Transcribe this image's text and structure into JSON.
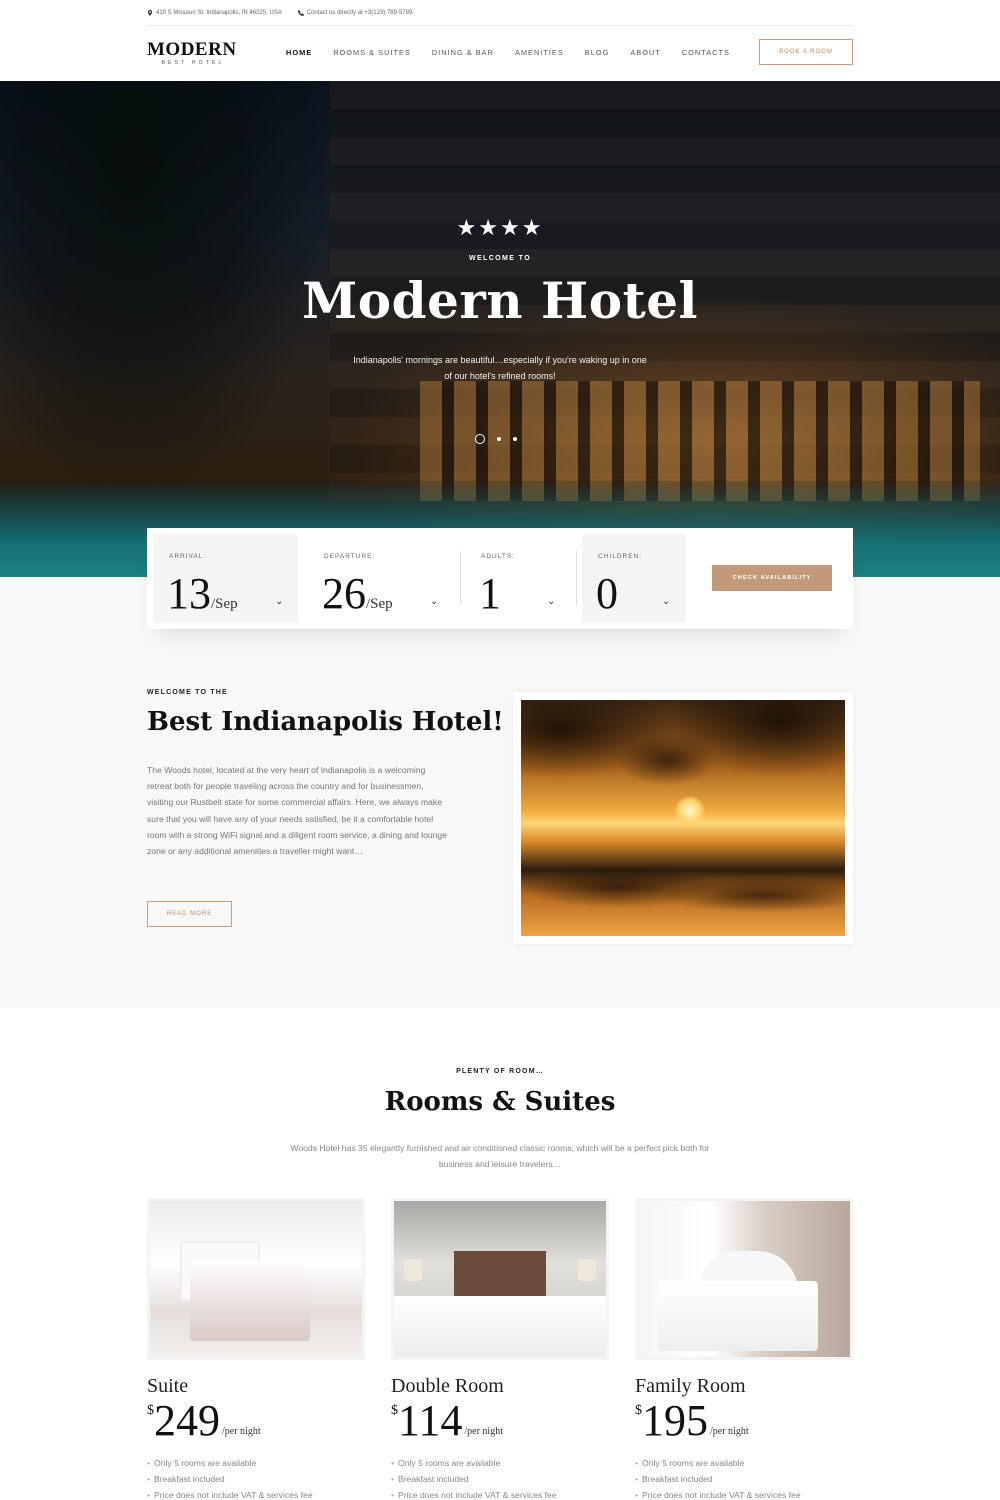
{
  "topbar": {
    "address": "410 S Missouri St, Indianapolis, IN 46225, USA",
    "contact": "Contact us directly at +3(123) 789-5789"
  },
  "header": {
    "logo_name": "MODERN",
    "logo_sub": "BEST HOTEL",
    "nav": [
      "HOME",
      "ROOMS & SUITES",
      "DINING & BAR",
      "AMENITIES",
      "BLOG",
      "ABOUT",
      "CONTACTS"
    ],
    "active_nav": "HOME",
    "book_label": "BOOK A ROOM"
  },
  "hero": {
    "stars": "★★★★",
    "welcome": "WELCOME TO",
    "title": "Modern Hotel",
    "desc_line1": "Indianapolis' mornings are beautiful…especially if you're waking up in one",
    "desc_line2": "of our hotel's refined rooms!",
    "slides": 3,
    "active_slide": 1
  },
  "booking": {
    "arrival_label": "ARRIVAL:",
    "arrival_day": "13",
    "arrival_month": "/Sep",
    "departure_label": "DEPARTURE:",
    "departure_day": "26",
    "departure_month": "/Sep",
    "adults_label": "ADULTS:",
    "adults_value": "1",
    "children_label": "CHILDREN:",
    "children_value": "0",
    "check_label": "CHECK AVAILABILITY",
    "chevron": "⌄"
  },
  "about": {
    "kicker": "WELCOME TO THE",
    "title": "Best Indianapolis Hotel!",
    "text": "The Woods hotel, located at the very heart of Indianapolis is a welcoming retreat both for people traveling across the country and for businessmen, visiting our Rustbelt state for some commercial affairs. Here, we always make sure that you will have any of your needs satisfied, be it a comfortable hotel room with a strong WiFi signal and a diligent room service, a dining and lounge zone or any additional amenities a traveller might want…",
    "read_more": "READ MORE"
  },
  "rooms": {
    "kicker": "PLENTY OF ROOM…",
    "title": "Rooms & Suites",
    "desc_line1": "Woods Hotel has 35 elegantly furnished and air conditioned classic rooms, which will be a perfect pick both for",
    "desc_line2": "business and leisure travelers…",
    "currency": "$",
    "per": "/per night",
    "items": [
      {
        "name": "Suite",
        "price": "249",
        "features": [
          "Only 5 rooms are available",
          "Breakfast included",
          "Price does not include VAT & services fee"
        ]
      },
      {
        "name": "Double Room",
        "price": "114",
        "features": [
          "Only 5 rooms are available",
          "Breakfast included",
          "Price does not include VAT & services fee"
        ]
      },
      {
        "name": "Family Room",
        "price": "195",
        "features": [
          "Only 5 rooms are available",
          "Breakfast included",
          "Price does not include VAT & services fee"
        ]
      }
    ]
  },
  "colors": {
    "accent": "#c29a7a",
    "text_dark": "#111111",
    "text_muted": "#888888"
  }
}
